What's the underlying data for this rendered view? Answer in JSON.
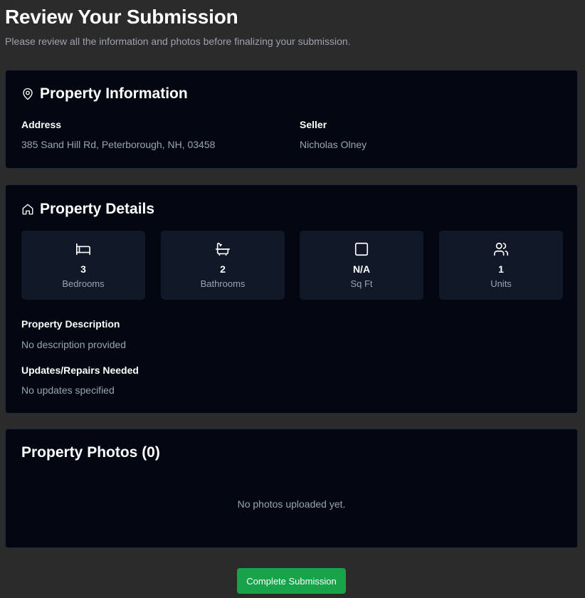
{
  "header": {
    "title": "Review Your Submission",
    "subtitle": "Please review all the information and photos before finalizing your submission."
  },
  "property_information": {
    "title": "Property Information",
    "icon": "map-pin-icon",
    "address_label": "Address",
    "address_value": "385 Sand Hill Rd, Peterborough, NH, 03458",
    "seller_label": "Seller",
    "seller_value": "Nicholas Olney"
  },
  "property_details": {
    "title": "Property Details",
    "icon": "home-icon",
    "stats": [
      {
        "icon": "bed-icon",
        "value": "3",
        "label": "Bedrooms"
      },
      {
        "icon": "bath-icon",
        "value": "2",
        "label": "Bathrooms"
      },
      {
        "icon": "square-icon",
        "value": "N/A",
        "label": "Sq Ft"
      },
      {
        "icon": "users-icon",
        "value": "1",
        "label": "Units"
      }
    ],
    "description_label": "Property Description",
    "description_value": "No description provided",
    "updates_label": "Updates/Repairs Needed",
    "updates_value": "No updates specified"
  },
  "property_photos": {
    "title": "Property Photos (0)",
    "empty_text": "No photos uploaded yet."
  },
  "actions": {
    "complete_label": "Complete Submission"
  },
  "colors": {
    "background": "#2b2b2b",
    "card": "#030712",
    "stat_tile": "#111827",
    "muted_text": "#9ca3af",
    "accent": "#16a34a"
  }
}
